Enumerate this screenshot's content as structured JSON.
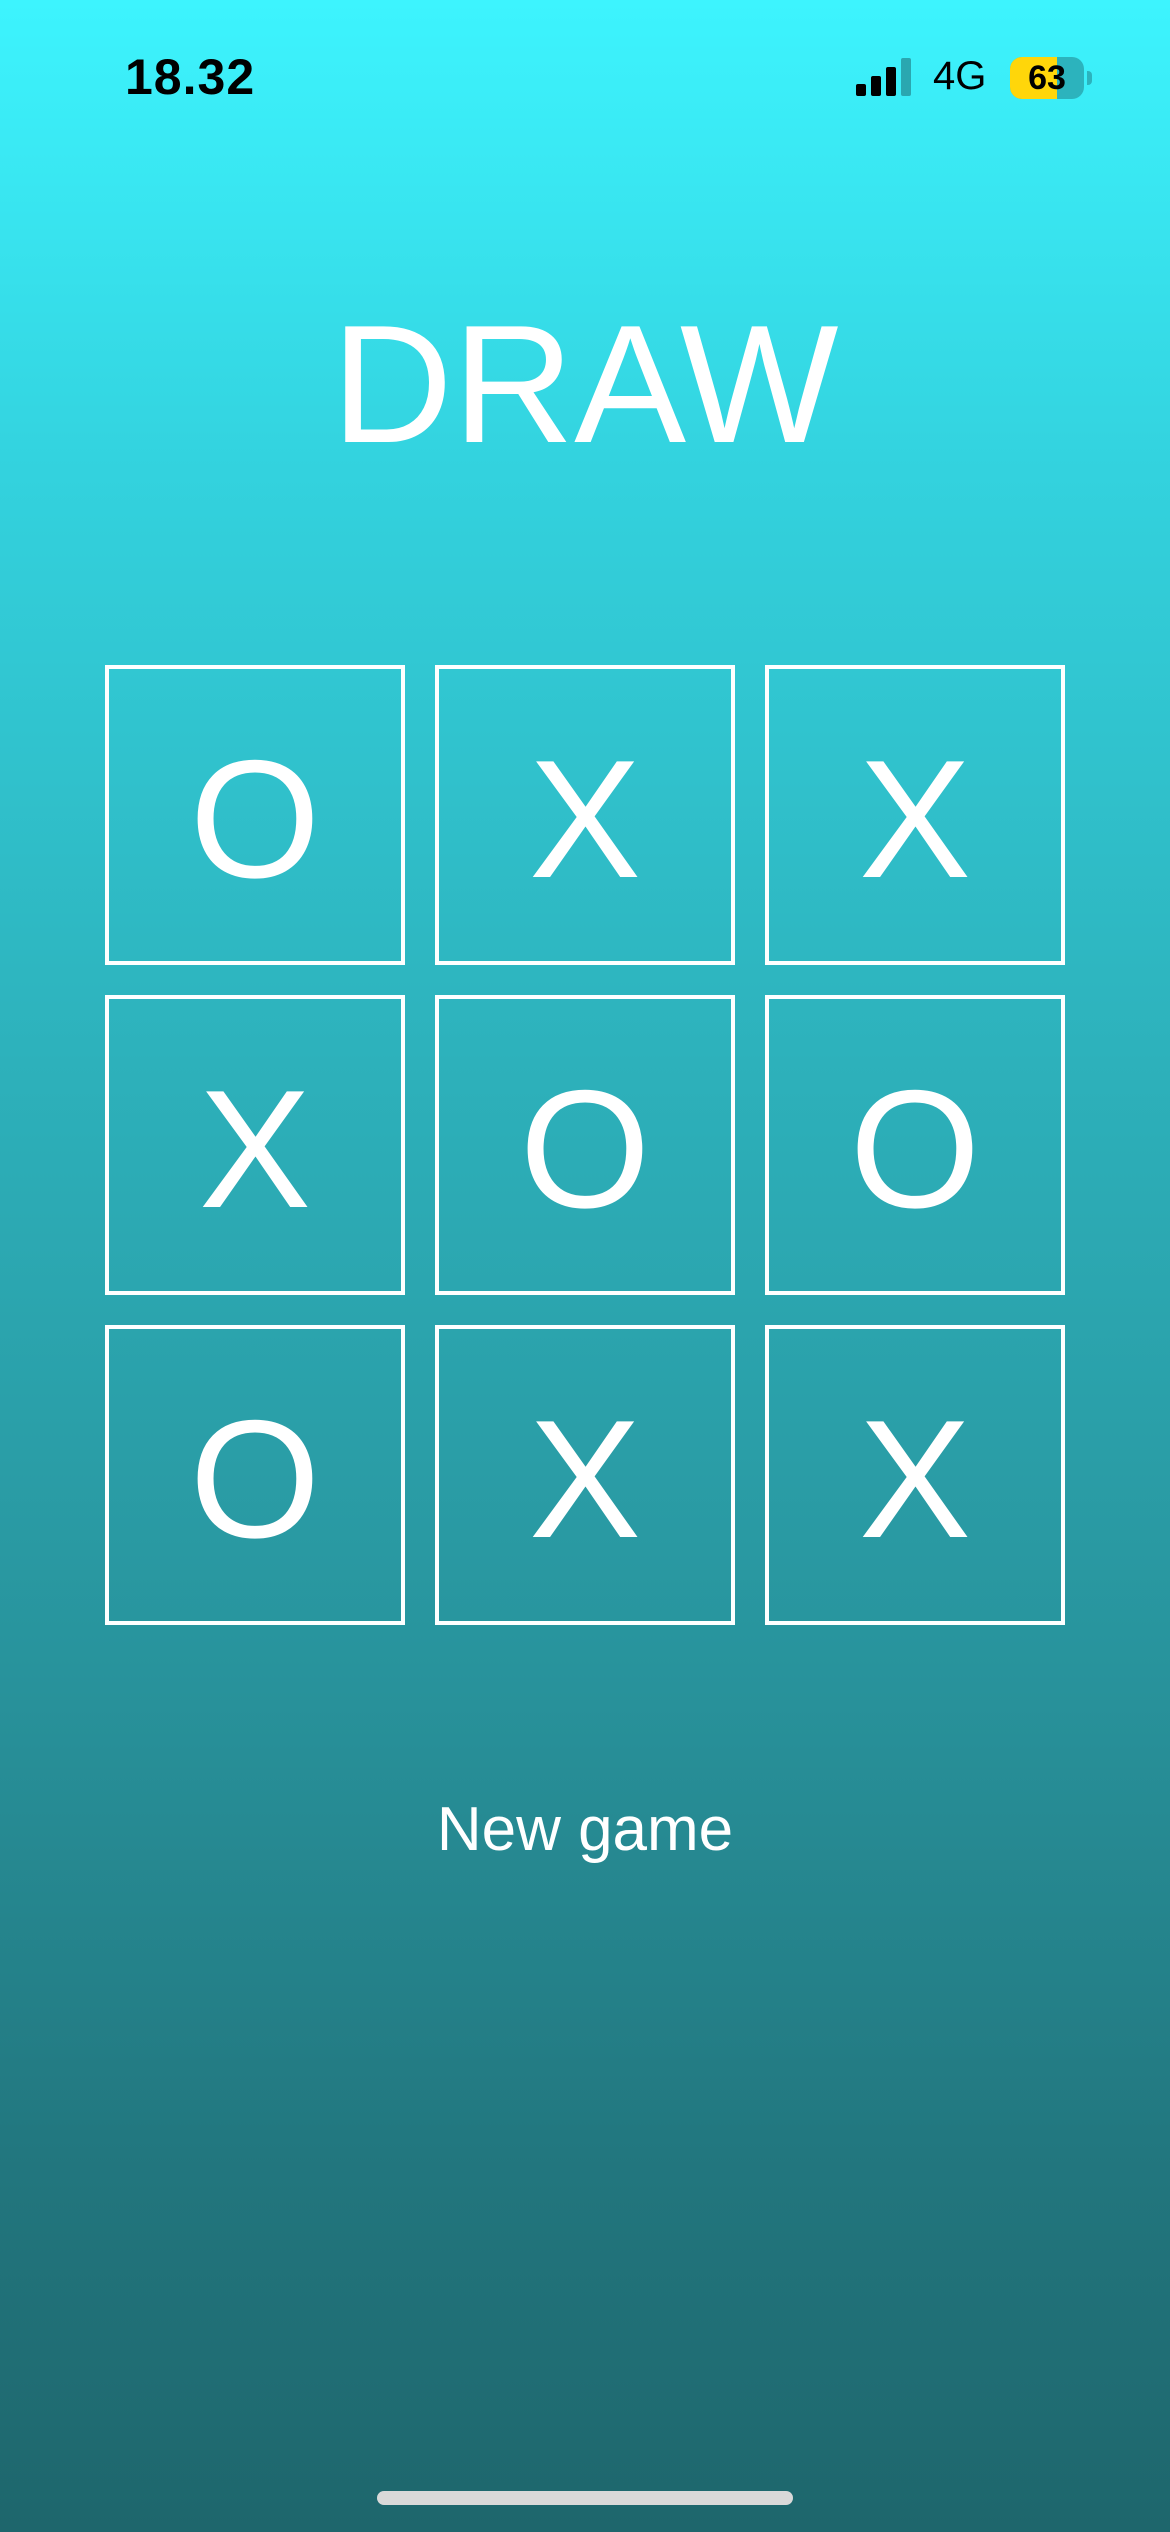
{
  "status_bar": {
    "time": "18.32",
    "network": "4G",
    "battery_level": "63",
    "battery_fraction": 0.63,
    "signal_bars_active": 3,
    "signal_bars_total": 4
  },
  "game": {
    "result_title": "DRAW",
    "board": [
      [
        "O",
        "X",
        "X"
      ],
      [
        "X",
        "O",
        "O"
      ],
      [
        "O",
        "X",
        "X"
      ]
    ],
    "new_game_label": "New game"
  },
  "colors": {
    "gradient_top": "#3df4fe",
    "gradient_bottom": "#1e666c",
    "foreground": "#ffffff",
    "battery_fill": "#ffd60a"
  },
  "icons": {
    "signal": "cellular-signal-icon",
    "battery": "battery-icon"
  }
}
